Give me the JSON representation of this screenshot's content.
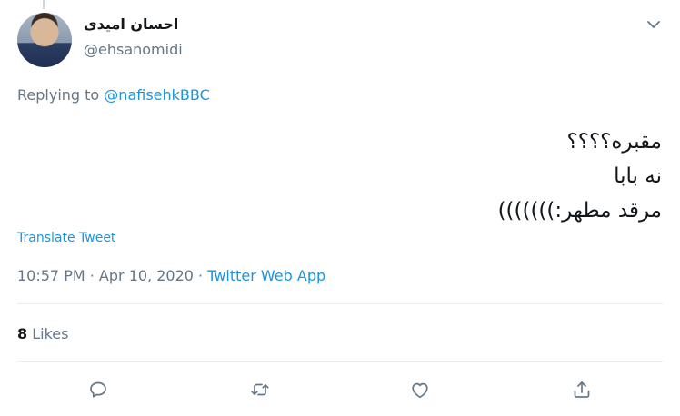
{
  "user": {
    "display_name": "احسان امیدی",
    "handle": "@ehsanomidi"
  },
  "reply": {
    "prefix": "Replying to",
    "to": "@nafisehkBBC"
  },
  "tweet": {
    "lines": [
      "مقبره؟؟؟؟",
      "نه بابا",
      "مرقد مطهر:)))))))"
    ]
  },
  "translate_label": "Translate Tweet",
  "meta": {
    "time": "10:57 PM",
    "sep1": " · ",
    "date": "Apr 10, 2020",
    "sep2": " · ",
    "source": "Twitter Web App"
  },
  "stats": {
    "likes_count": "8",
    "likes_label": "Likes"
  },
  "actions": [
    "reply-icon",
    "retweet-icon",
    "like-icon",
    "share-icon"
  ],
  "colors": {
    "accent": "#1b95e0",
    "muted": "#657786",
    "text": "#14171a",
    "divider": "#e6ecf0"
  }
}
